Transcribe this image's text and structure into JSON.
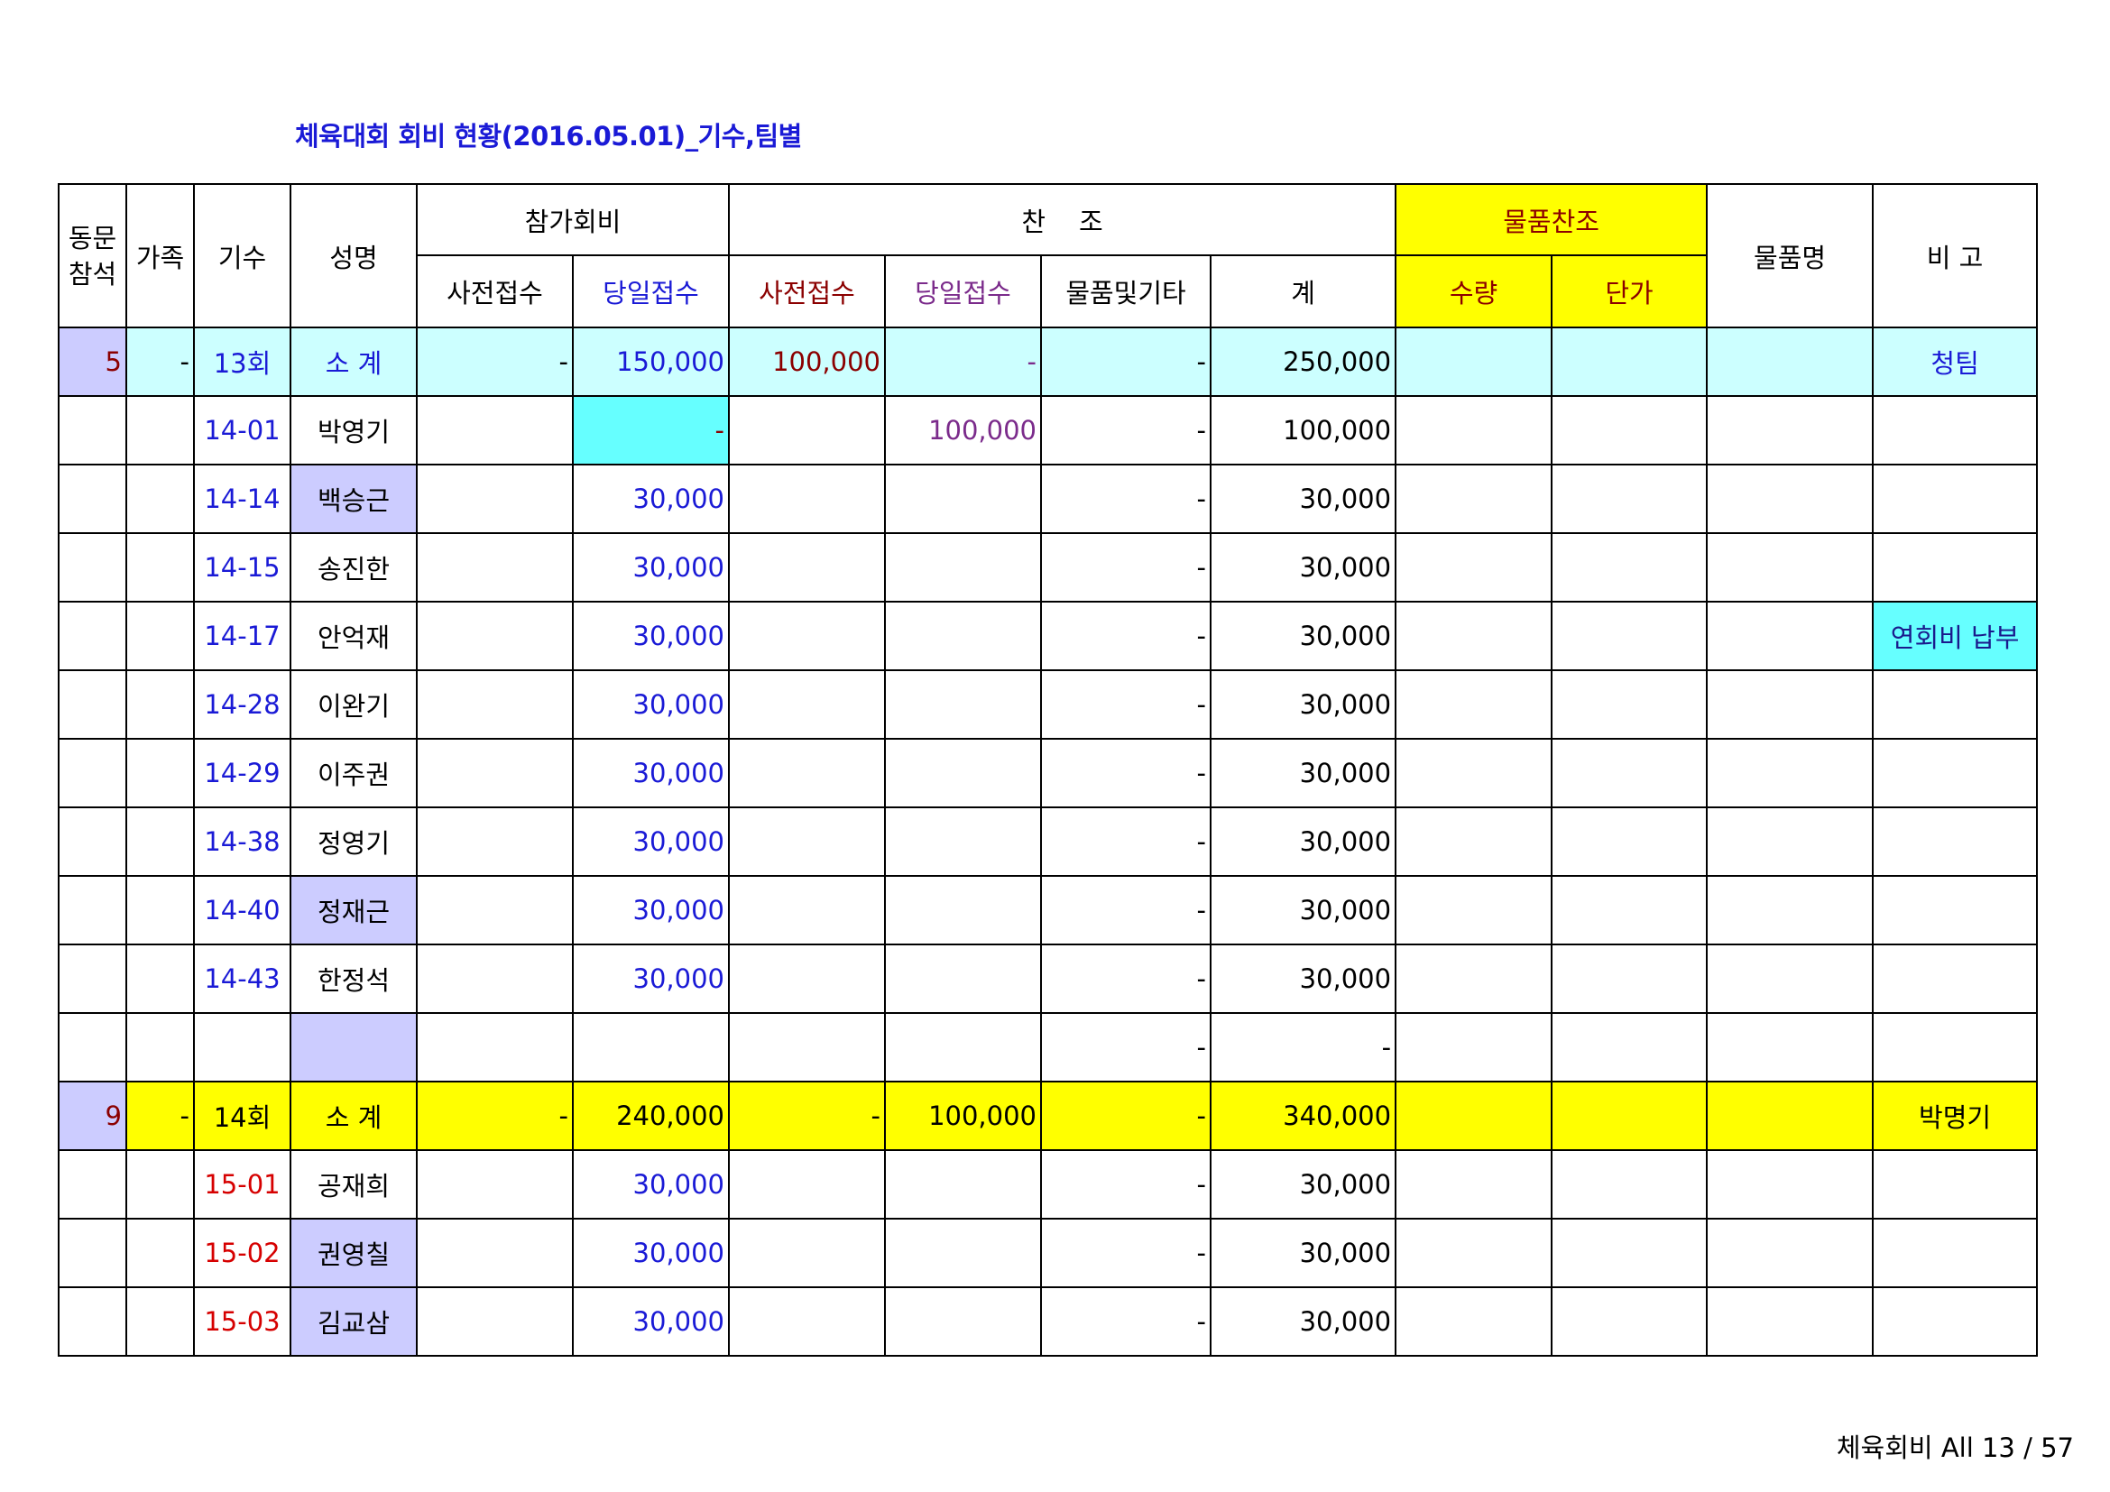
{
  "title": "체육대회 회비 현황(2016.05.01)_기수,팀별",
  "header": {
    "col_dongmun": "동문\n참석",
    "col_family": "가족",
    "col_gisu": "기수",
    "col_name": "성명",
    "group_fee": "참가회비",
    "group_support": "찬    조",
    "group_goods": "물품찬조",
    "col_goods_name": "물품명",
    "col_note": "비 고",
    "fee_pre": "사전접수",
    "fee_day": "당일접수",
    "sup_pre": "사전접수",
    "sup_day": "당일접수",
    "sup_goods": "물품및기타",
    "sup_total": "계",
    "goods_qty": "수량",
    "goods_price": "단가"
  },
  "rows": [
    {
      "kind": "subtotal13",
      "attend": "5",
      "family": "-",
      "gisu": "13회",
      "name": "소   계",
      "fee_pre": "-",
      "fee_day": "150,000",
      "sup_pre": "100,000",
      "sup_day": "-",
      "sup_goods": "-",
      "total": "250,000",
      "qty": "",
      "price": "",
      "goods_name": "",
      "note": "청팀"
    },
    {
      "kind": "member",
      "attend": "",
      "family": "",
      "gisu": "14-01",
      "name": "박영기",
      "fee_pre": "",
      "fee_day": "-",
      "sup_pre": "",
      "sup_day": "100,000",
      "sup_goods": "-",
      "total": "100,000",
      "qty": "",
      "price": "",
      "goods_name": "",
      "note": ""
    },
    {
      "kind": "member",
      "attend": "",
      "family": "",
      "gisu": "14-14",
      "name": "백승근",
      "fee_pre": "",
      "fee_day": "30,000",
      "sup_pre": "",
      "sup_day": "",
      "sup_goods": "-",
      "total": "30,000",
      "qty": "",
      "price": "",
      "goods_name": "",
      "note": ""
    },
    {
      "kind": "member",
      "attend": "",
      "family": "",
      "gisu": "14-15",
      "name": "송진한",
      "fee_pre": "",
      "fee_day": "30,000",
      "sup_pre": "",
      "sup_day": "",
      "sup_goods": "-",
      "total": "30,000",
      "qty": "",
      "price": "",
      "goods_name": "",
      "note": ""
    },
    {
      "kind": "member",
      "attend": "",
      "family": "",
      "gisu": "14-17",
      "name": "안억재",
      "fee_pre": "",
      "fee_day": "30,000",
      "sup_pre": "",
      "sup_day": "",
      "sup_goods": "-",
      "total": "30,000",
      "qty": "",
      "price": "",
      "goods_name": "",
      "note": "연회비 납부"
    },
    {
      "kind": "member",
      "attend": "",
      "family": "",
      "gisu": "14-28",
      "name": "이완기",
      "fee_pre": "",
      "fee_day": "30,000",
      "sup_pre": "",
      "sup_day": "",
      "sup_goods": "-",
      "total": "30,000",
      "qty": "",
      "price": "",
      "goods_name": "",
      "note": ""
    },
    {
      "kind": "member",
      "attend": "",
      "family": "",
      "gisu": "14-29",
      "name": "이주권",
      "fee_pre": "",
      "fee_day": "30,000",
      "sup_pre": "",
      "sup_day": "",
      "sup_goods": "-",
      "total": "30,000",
      "qty": "",
      "price": "",
      "goods_name": "",
      "note": ""
    },
    {
      "kind": "member",
      "attend": "",
      "family": "",
      "gisu": "14-38",
      "name": "정영기",
      "fee_pre": "",
      "fee_day": "30,000",
      "sup_pre": "",
      "sup_day": "",
      "sup_goods": "-",
      "total": "30,000",
      "qty": "",
      "price": "",
      "goods_name": "",
      "note": ""
    },
    {
      "kind": "member",
      "attend": "",
      "family": "",
      "gisu": "14-40",
      "name": "정재근",
      "fee_pre": "",
      "fee_day": "30,000",
      "sup_pre": "",
      "sup_day": "",
      "sup_goods": "-",
      "total": "30,000",
      "qty": "",
      "price": "",
      "goods_name": "",
      "note": ""
    },
    {
      "kind": "member",
      "attend": "",
      "family": "",
      "gisu": "14-43",
      "name": "한정석",
      "fee_pre": "",
      "fee_day": "30,000",
      "sup_pre": "",
      "sup_day": "",
      "sup_goods": "-",
      "total": "30,000",
      "qty": "",
      "price": "",
      "goods_name": "",
      "note": ""
    },
    {
      "kind": "blank",
      "attend": "",
      "family": "",
      "gisu": "",
      "name": "",
      "fee_pre": "",
      "fee_day": "",
      "sup_pre": "",
      "sup_day": "",
      "sup_goods": "-",
      "total": "-",
      "qty": "",
      "price": "",
      "goods_name": "",
      "note": ""
    },
    {
      "kind": "subtotal14",
      "attend": "9",
      "family": "-",
      "gisu": "14회",
      "name": "소   계",
      "fee_pre": "-",
      "fee_day": "240,000",
      "sup_pre": "-",
      "sup_day": "100,000",
      "sup_goods": "-",
      "total": "340,000",
      "qty": "",
      "price": "",
      "goods_name": "",
      "note": "박명기"
    },
    {
      "kind": "member15",
      "attend": "",
      "family": "",
      "gisu": "15-01",
      "name": "공재희",
      "fee_pre": "",
      "fee_day": "30,000",
      "sup_pre": "",
      "sup_day": "",
      "sup_goods": "-",
      "total": "30,000",
      "qty": "",
      "price": "",
      "goods_name": "",
      "note": ""
    },
    {
      "kind": "member15",
      "attend": "",
      "family": "",
      "gisu": "15-02",
      "name": "권영칠",
      "fee_pre": "",
      "fee_day": "30,000",
      "sup_pre": "",
      "sup_day": "",
      "sup_goods": "-",
      "total": "30,000",
      "qty": "",
      "price": "",
      "goods_name": "",
      "note": ""
    },
    {
      "kind": "member15",
      "attend": "",
      "family": "",
      "gisu": "15-03",
      "name": "김교삼",
      "fee_pre": "",
      "fee_day": "30,000",
      "sup_pre": "",
      "sup_day": "",
      "sup_goods": "-",
      "total": "30,000",
      "qty": "",
      "price": "",
      "goods_name": "",
      "note": ""
    }
  ],
  "footer": "체육회비 All 13 / 57"
}
